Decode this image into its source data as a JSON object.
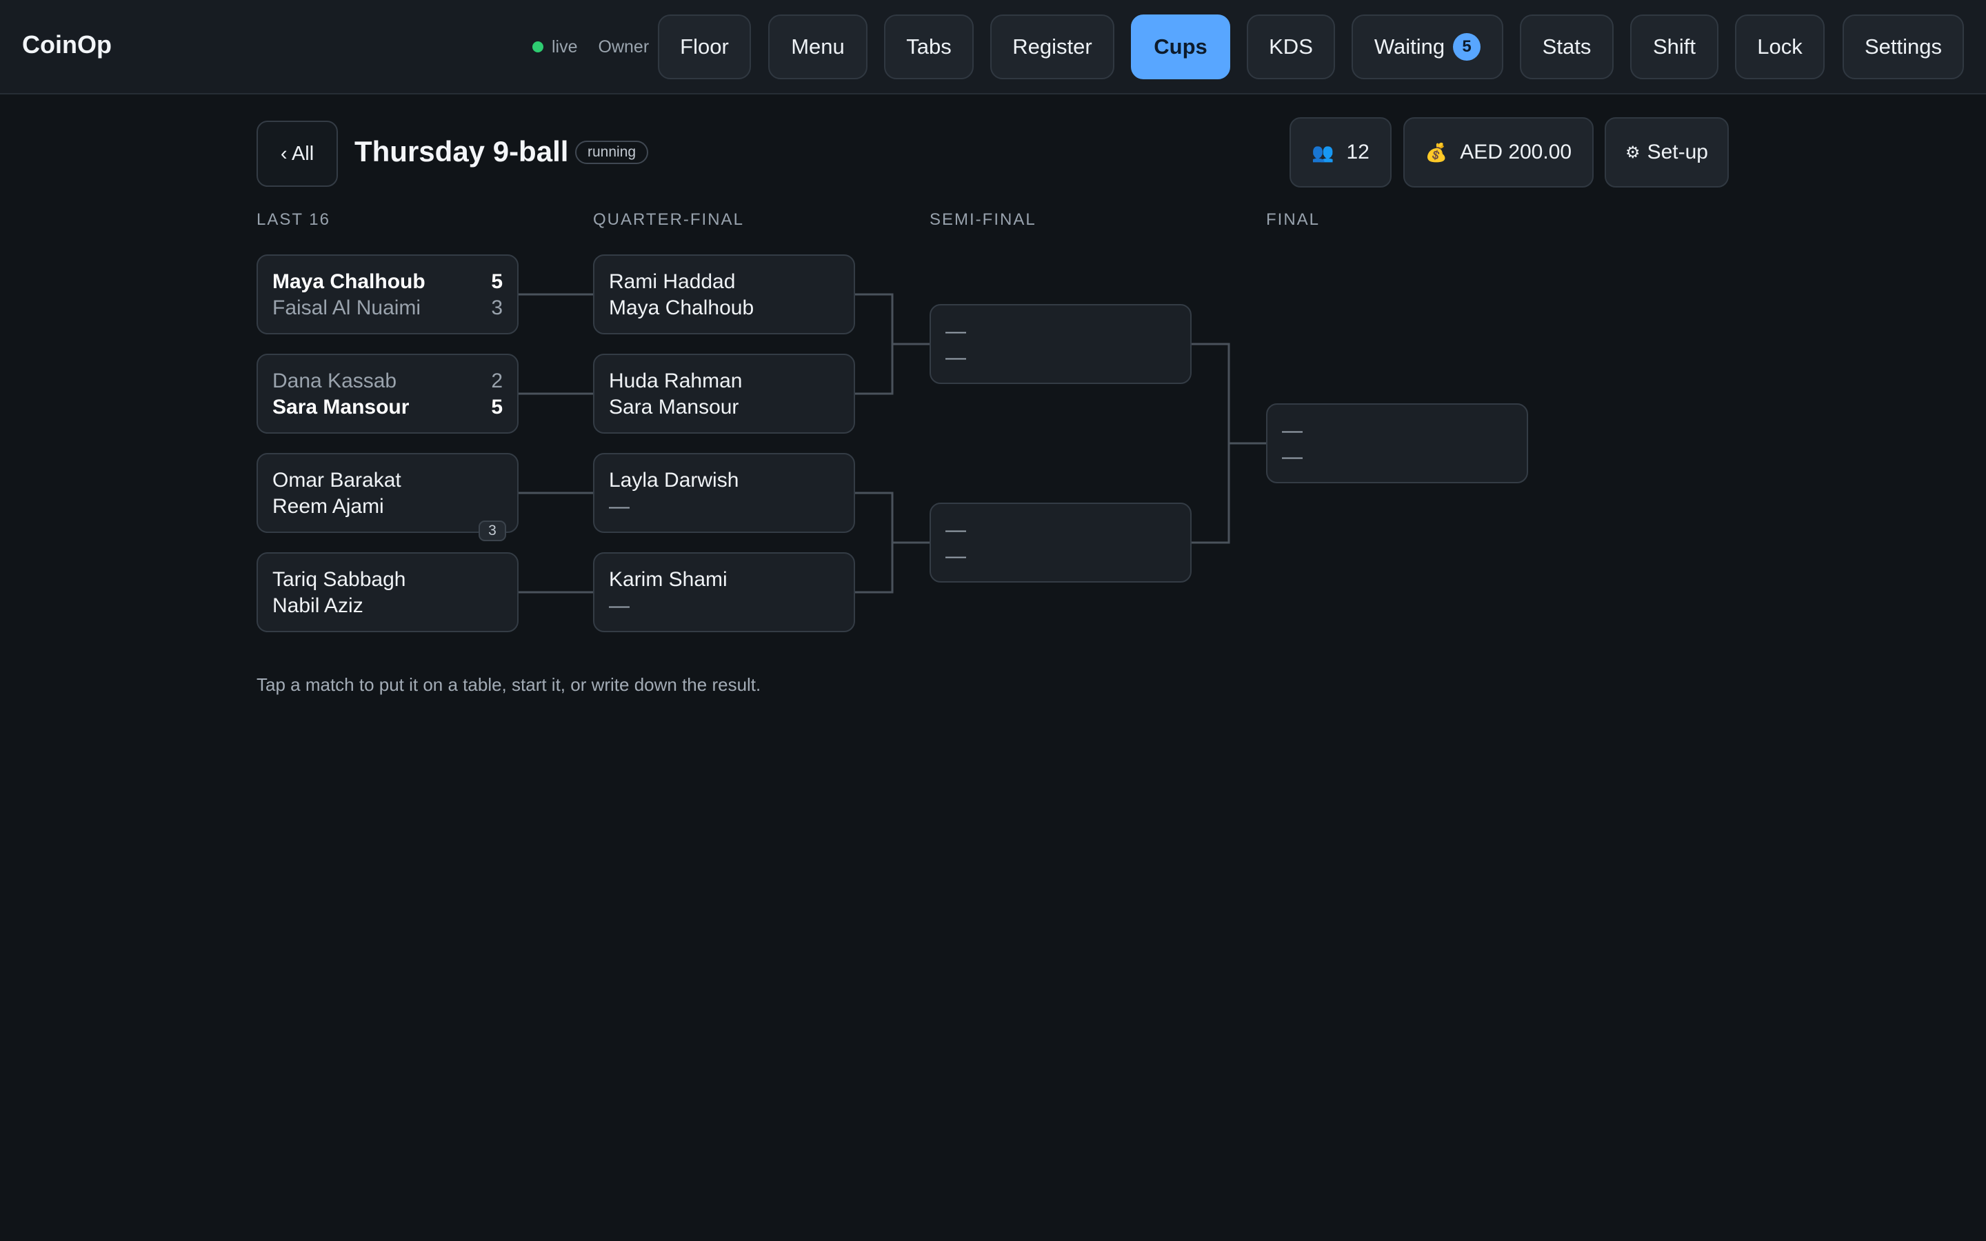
{
  "app": {
    "name": "CoinOp",
    "status": "live",
    "role": "Owner"
  },
  "nav": {
    "floor": "Floor",
    "menu": "Menu",
    "tabs": "Tabs",
    "register": "Register",
    "cups": "Cups",
    "kds": "KDS",
    "waiting": "Waiting",
    "waiting_count": "5",
    "stats": "Stats",
    "shift": "Shift",
    "lock": "Lock",
    "settings": "Settings"
  },
  "header": {
    "back_label": "‹ All",
    "title": "Thursday 9-ball",
    "status": "running",
    "players": "12",
    "prize": "AED 200.00",
    "setup_label": "Set-up"
  },
  "icons": {
    "players": "people-icon",
    "prize": "money-bag-icon",
    "setup": "gear-icon"
  },
  "rounds": [
    "LAST 16",
    "QUARTER-FINAL",
    "SEMI-FINAL",
    "FINAL"
  ],
  "matches": {
    "r16": [
      {
        "p1": "Maya Chalhoub",
        "s1": "5",
        "p2": "Faisal Al Nuaimi",
        "s2": "3"
      },
      {
        "p1": "Dana Kassab",
        "s1": "2",
        "p2": "Sara Mansour",
        "s2": "5"
      },
      {
        "p1": "Omar Barakat",
        "p2": "Reem Ajami",
        "table": "3"
      },
      {
        "p1": "Tariq Sabbagh",
        "p2": "Nabil Aziz"
      }
    ],
    "qf": [
      {
        "p1": "Rami Haddad",
        "p2": "Maya Chalhoub"
      },
      {
        "p1": "Huda Rahman",
        "p2": "Sara Mansour"
      },
      {
        "p1": "Layla Darwish",
        "p2": "—"
      },
      {
        "p1": "Karim Shami",
        "p2": "—"
      }
    ],
    "sf": [
      {
        "p1": "—",
        "p2": "—"
      },
      {
        "p1": "—",
        "p2": "—"
      }
    ],
    "final": {
      "p1": "—",
      "p2": "—"
    }
  },
  "hint": "Tap a match to put it on a table, start it, or write down the result."
}
